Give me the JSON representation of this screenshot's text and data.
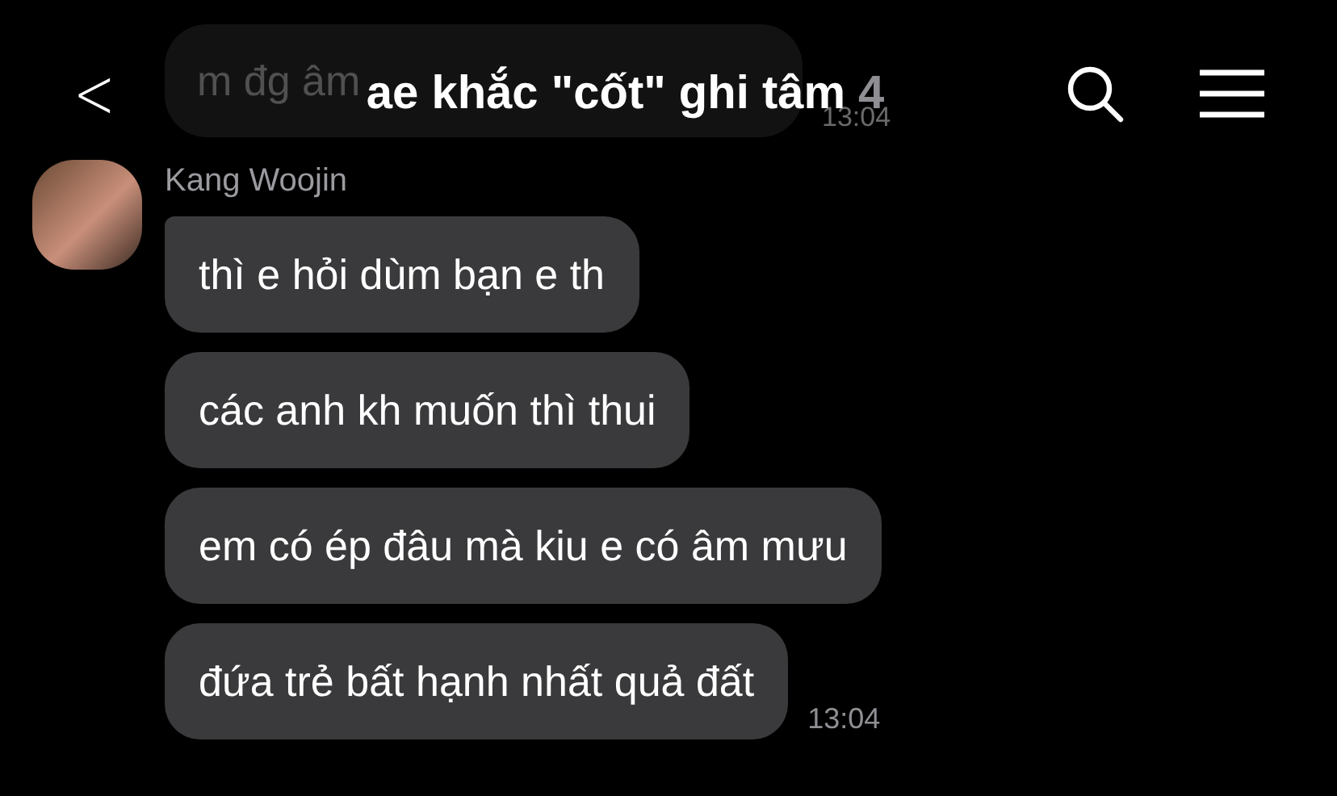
{
  "background_message": {
    "text": "m đg âm",
    "time": "13:04"
  },
  "header": {
    "back": "<",
    "title": "ae khắc \"cốt\" ghi tâm",
    "member_count": "4"
  },
  "sender": {
    "name": "Kang Woojin"
  },
  "messages": [
    {
      "text": "thì e hỏi dùm bạn e th"
    },
    {
      "text": "các anh kh muốn thì thui"
    },
    {
      "text": "em có ép đâu mà kiu e có âm mưu"
    },
    {
      "text": "đứa trẻ bất hạnh nhất quả đất",
      "time": "13:04"
    }
  ]
}
